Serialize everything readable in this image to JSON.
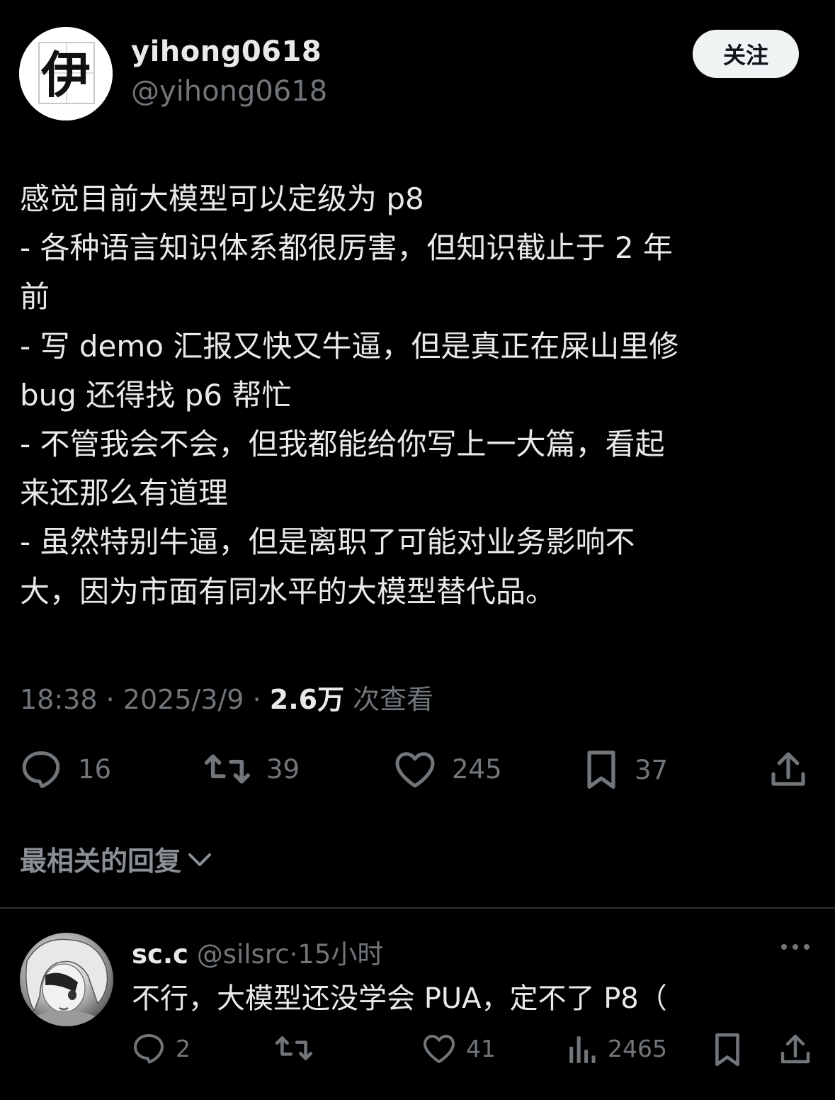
{
  "tweet": {
    "display_name": "yihong0618",
    "handle": "@yihong0618",
    "follow_label": "关注",
    "avatar_glyph": "伊",
    "text_lines": [
      "感觉目前大模型可以定级为 p8",
      "- 各种语言知识体系都很厉害，但知识截止于 2 年",
      "前",
      "- 写 demo 汇报又快又牛逼，但是真正在屎山里修",
      "bug 还得找 p6 帮忙",
      "- 不管我会不会，但我都能给你写上一大篇，看起",
      "来还那么有道理",
      "- 虽然特别牛逼，但是离职了可能对业务影响不",
      "大，因为市面有同水平的大模型替代品。"
    ],
    "time": "18:38",
    "date": "2025/3/9",
    "views": "2.6万",
    "views_suffix": "次查看",
    "separator": "·",
    "stats": {
      "replies": "16",
      "retweets": "39",
      "likes": "245",
      "bookmarks": "37"
    }
  },
  "replies_filter_label": "最相关的回复",
  "reply": {
    "name": "sc.c",
    "handle": "@silsrc",
    "separator": "·",
    "time": "15小时",
    "text": "不行，大模型还没学会 PUA，定不了 P8（",
    "stats": {
      "replies": "2",
      "likes": "41",
      "views": "2465"
    }
  },
  "icons": [
    "reply-icon",
    "retweet-icon",
    "like-icon",
    "bookmark-icon",
    "share-icon",
    "chevron-down-icon",
    "more-icon",
    "views-icon"
  ],
  "colors": {
    "background": "#000000",
    "text": "#e7e9ea",
    "muted": "#71767b",
    "button_bg": "#eff3f4"
  }
}
